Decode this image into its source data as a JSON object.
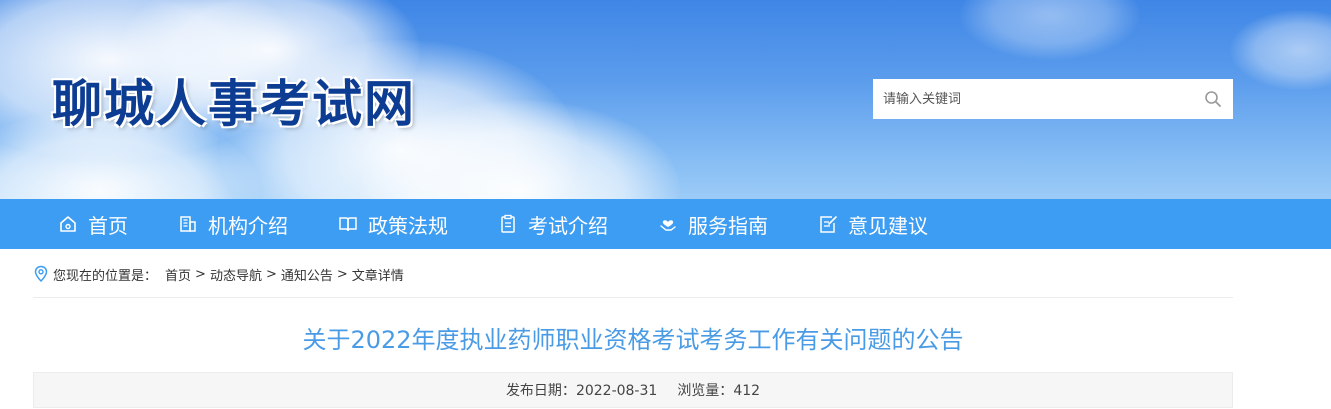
{
  "header": {
    "site_title": "聊城人事考试网",
    "search_placeholder": "请输入关键词"
  },
  "nav": {
    "items": [
      {
        "label": "首页",
        "icon": "home-icon"
      },
      {
        "label": "机构介绍",
        "icon": "building-icon"
      },
      {
        "label": "政策法规",
        "icon": "book-icon"
      },
      {
        "label": "考试介绍",
        "icon": "clipboard-icon"
      },
      {
        "label": "服务指南",
        "icon": "heart-hand-icon"
      },
      {
        "label": "意见建议",
        "icon": "edit-note-icon"
      }
    ]
  },
  "breadcrumb": {
    "prefix": "您现在的位置是：",
    "items": [
      "首页",
      "动态导航",
      "通知公告",
      "文章详情"
    ],
    "separator": ">"
  },
  "article": {
    "title": "关于2022年度执业药师职业资格考试考务工作有关问题的公告",
    "date_label": "发布日期：",
    "date": "2022-08-31",
    "views_label": "浏览量：",
    "views": "412"
  },
  "colors": {
    "nav_bg": "#3d9df3",
    "title_blue": "#4a9be6",
    "site_title": "#0d3d93"
  }
}
